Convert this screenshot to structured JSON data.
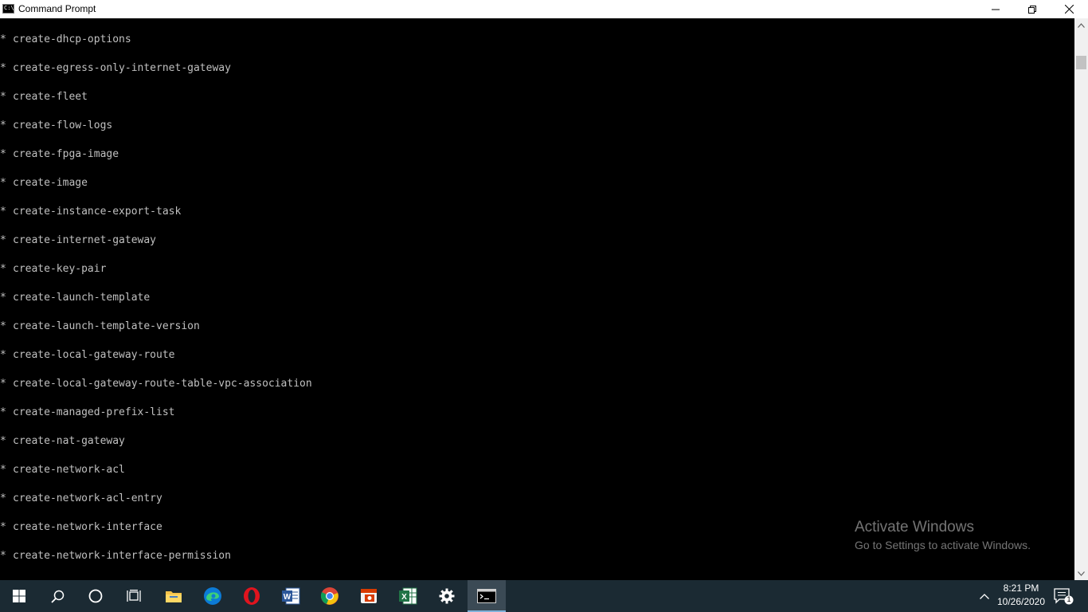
{
  "window": {
    "title": "Command Prompt",
    "buttons": {
      "minimize": "minimize-icon",
      "restore": "restore-icon",
      "close": "close-icon"
    }
  },
  "console": {
    "bullet": "*",
    "lines": [
      "create-dhcp-options",
      "create-egress-only-internet-gateway",
      "create-fleet",
      "create-flow-logs",
      "create-fpga-image",
      "create-image",
      "create-instance-export-task",
      "create-internet-gateway",
      "create-key-pair",
      "create-launch-template",
      "create-launch-template-version",
      "create-local-gateway-route",
      "create-local-gateway-route-table-vpc-association",
      "create-managed-prefix-list",
      "create-nat-gateway",
      "create-network-acl",
      "create-network-acl-entry",
      "create-network-interface",
      "create-network-interface-permission"
    ],
    "colors": {
      "background": "#000000",
      "text": "#c0c0c0"
    }
  },
  "watermark": {
    "title": "Activate Windows",
    "subtitle": "Go to Settings to activate Windows."
  },
  "taskbar": {
    "items": [
      {
        "name": "start-button",
        "icon": "windows-logo-icon"
      },
      {
        "name": "search-button",
        "icon": "search-icon"
      },
      {
        "name": "cortana-button",
        "icon": "cortana-circle-icon"
      },
      {
        "name": "task-view-button",
        "icon": "task-view-icon"
      },
      {
        "name": "file-explorer-button",
        "icon": "folder-icon"
      },
      {
        "name": "edge-button",
        "icon": "edge-icon"
      },
      {
        "name": "opera-button",
        "icon": "opera-icon"
      },
      {
        "name": "word-button",
        "icon": "word-icon"
      },
      {
        "name": "chrome-button",
        "icon": "chrome-icon"
      },
      {
        "name": "red-app-button",
        "icon": "red-app-icon"
      },
      {
        "name": "excel-button",
        "icon": "excel-icon"
      },
      {
        "name": "settings-button",
        "icon": "gear-icon"
      },
      {
        "name": "command-prompt-button",
        "icon": "cmd-icon",
        "active": true
      }
    ],
    "tray": {
      "time": "8:21 PM",
      "date": "10/26/2020",
      "notification_count": "1"
    },
    "colors": {
      "background": "#1b2a33",
      "active_bg": "#3b4a55",
      "active_indicator": "#7fb2d9"
    }
  }
}
